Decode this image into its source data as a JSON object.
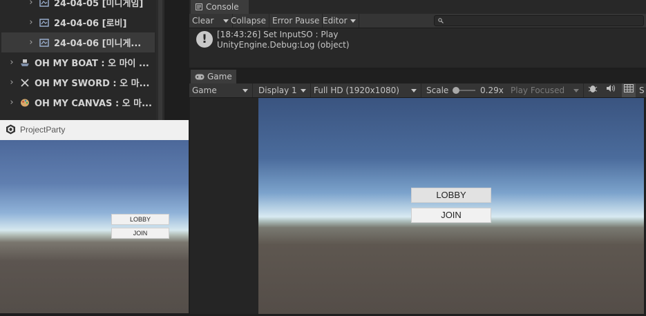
{
  "explorer": {
    "items": [
      {
        "label": "24-04-05 [미니게임]",
        "icon": "scene-icon"
      },
      {
        "label": "24-04-06 [로비]",
        "icon": "scene-icon"
      },
      {
        "label": "24-04-06 [미니게...",
        "icon": "scene-icon",
        "selected": true
      },
      {
        "label": "OH MY BOAT : 오 마이 ...",
        "icon": "boat-icon"
      },
      {
        "label": "OH MY SWORD : 오 마...",
        "icon": "sword-icon"
      },
      {
        "label": "OH MY CANVAS : 오 마...",
        "icon": "palette-icon"
      }
    ]
  },
  "console": {
    "tab_label": "Console",
    "toolbar": {
      "clear": "Clear",
      "collapse": "Collapse",
      "error_pause": "Error Pause",
      "editor": "Editor"
    },
    "search_placeholder": "",
    "log": {
      "line1": "[18:43:26] Set InputSO : Play",
      "line2": "UnityEngine.Debug:Log (object)"
    }
  },
  "game": {
    "tab_label": "Game",
    "toolbar": {
      "view_mode": "Game",
      "display": "Display 1",
      "resolution": "Full HD (1920x1080)",
      "scale_label": "Scale",
      "scale_value": "0.29x",
      "play_mode": "Play Focused",
      "trailing_cut": "S"
    },
    "buttons": {
      "lobby": "LOBBY",
      "join": "JOIN"
    }
  },
  "project_window": {
    "title": "ProjectParty",
    "buttons": {
      "lobby": "LOBBY",
      "join": "JOIN"
    }
  },
  "colors": {
    "editor_bg": "#282828",
    "toolbar_bg": "#353535",
    "tab_active": "#3c3c3c"
  }
}
